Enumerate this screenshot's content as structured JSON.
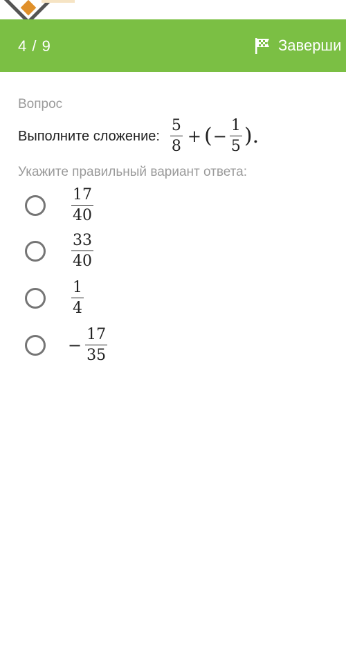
{
  "colors": {
    "accent": "#7bbf44",
    "header_text": "#ffffff",
    "muted_text": "#9a9a9a",
    "body_text": "#212121",
    "radio_border": "#757575"
  },
  "header": {
    "counter": "4 / 9",
    "finish_label": "Заверши",
    "finish_icon": "checkered-flag-icon"
  },
  "question": {
    "section_label": "Вопрос",
    "prompt": "Выполните сложение:",
    "expression": {
      "a_num": "5",
      "a_den": "8",
      "plus": "+",
      "open_paren": "(",
      "minus": "−",
      "b_num": "1",
      "b_den": "5",
      "close_paren": ").",
      "raw": "5/8 + (−1/5)."
    },
    "instruction": "Укажите правильный вариант ответа:"
  },
  "options": [
    {
      "sign": "",
      "num": "17",
      "den": "40",
      "selected": false
    },
    {
      "sign": "",
      "num": "33",
      "den": "40",
      "selected": false
    },
    {
      "sign": "",
      "num": "1",
      "den": "4",
      "selected": false
    },
    {
      "sign": "−",
      "num": "17",
      "den": "35",
      "selected": false
    }
  ]
}
